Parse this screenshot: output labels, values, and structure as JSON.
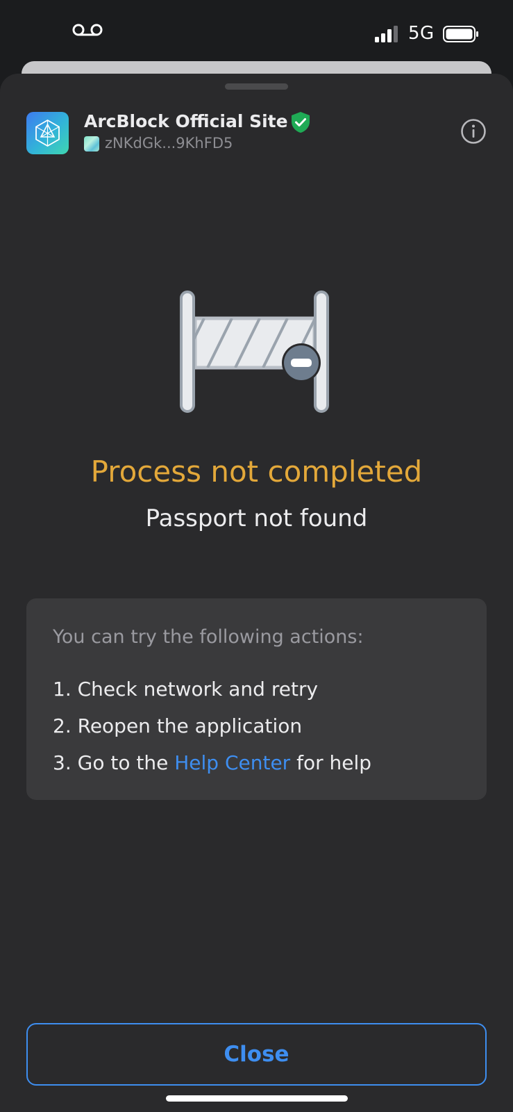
{
  "status_bar": {
    "network": "5G",
    "voicemail_icon": "voicemail-icon",
    "signal_icon": "cellular-signal-icon",
    "battery_icon": "battery-icon"
  },
  "header": {
    "site_title": "ArcBlock Official Site",
    "did_address": "zNKdGk...9KhFD5",
    "verified_icon": "verified-shield-icon",
    "info_icon": "info-icon"
  },
  "result": {
    "illustration": "road-barrier-blocked-icon",
    "title": "Process not completed",
    "subtitle": "Passport not found",
    "title_color": "#e3a83a"
  },
  "actions": {
    "heading": "You can try the following actions:",
    "item1": "1. Check network and retry",
    "item2": "2. Reopen the application",
    "item3_prefix": "3. Go to the ",
    "item3_link": "Help Center",
    "item3_suffix": " for help",
    "link_color": "#3e8ef0"
  },
  "footer": {
    "close_label": "Close"
  }
}
